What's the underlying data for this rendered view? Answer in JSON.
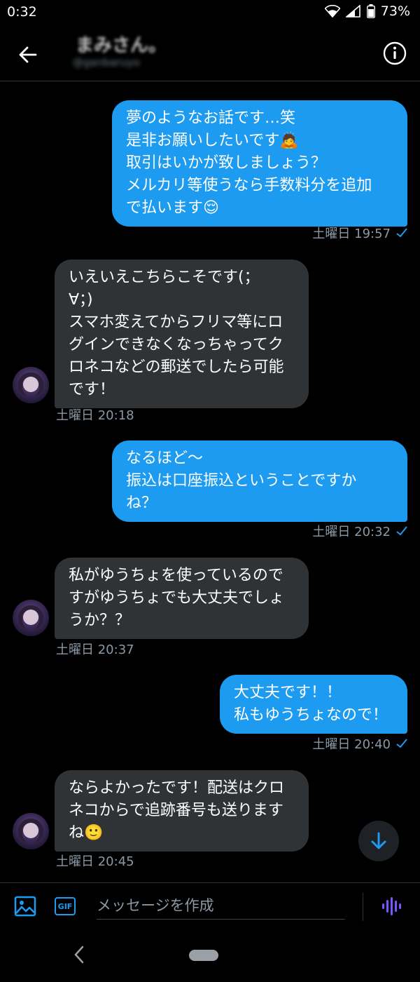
{
  "status_bar": {
    "time": "0:32",
    "battery_pct": "73%"
  },
  "header": {
    "contact_name": "まみさん。",
    "contact_handle": "@ganbaruyo"
  },
  "messages": [
    {
      "dir": "out",
      "text": "夢のようなお話です…笑\n是非お願いしたいです🙇\n取引はいかが致しましょう？\nメルカリ等使うなら手数料分を追加\nで払います😌",
      "time": "土曜日 19:57",
      "read": true
    },
    {
      "dir": "in",
      "text": "いえいえこちらこそです(；\n∀；)\nスマホ変えてからフリマ等にロ\nグインできなくなっちゃってク\nロネコなどの郵送でしたら可能\nです！",
      "time": "土曜日 20:18"
    },
    {
      "dir": "out",
      "text": "なるほど〜\n振込は口座振込ということですか\nね？",
      "time": "土曜日 20:32",
      "read": true
    },
    {
      "dir": "in",
      "text": "私がゆうちょを使っているので\nすがゆうちょでも大丈夫でしょ\nうか？？",
      "time": "土曜日 20:37"
    },
    {
      "dir": "out",
      "text": "大丈夫です！！\n私もゆうちょなので！",
      "time": "土曜日 20:40",
      "read": true
    },
    {
      "dir": "in",
      "text": "ならよかったです！配送はクロ\nネコからで追跡番号も送ります\nね🙂",
      "time": "土曜日 20:45"
    }
  ],
  "composer": {
    "placeholder": "メッセージを作成",
    "gif_label": "GIF"
  },
  "icons": {
    "back": "arrow-left-icon",
    "info": "info-icon",
    "image": "image-icon",
    "gif": "gif-icon",
    "voice": "voice-icon",
    "scroll": "arrow-down-icon",
    "read": "check-icon",
    "nav_back": "chevron-left-icon"
  },
  "colors": {
    "accent": "#1d9bf0",
    "bubble_in": "#2f3336",
    "background": "#000000",
    "muted": "#8b98a5"
  }
}
